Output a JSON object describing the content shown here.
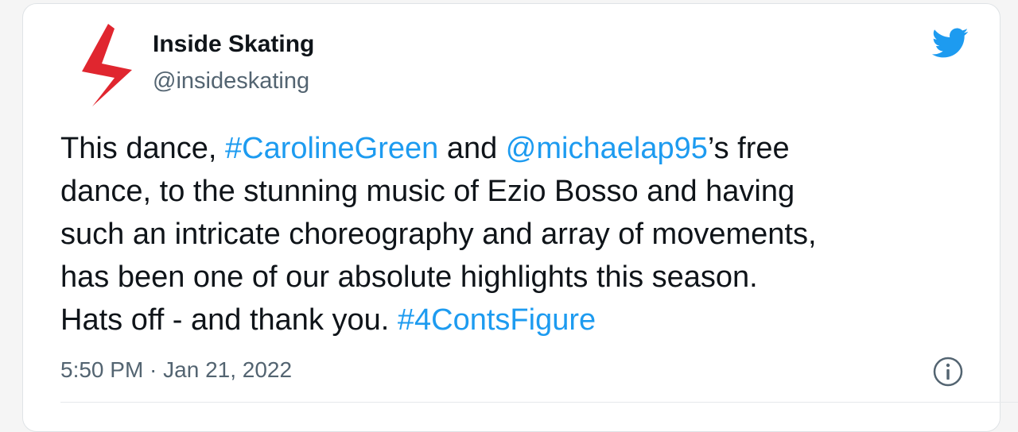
{
  "author": {
    "name": "Inside Skating",
    "handle": "@insideskating"
  },
  "tweet": {
    "lines": [
      [
        {
          "text": "This dance, ",
          "type": "text"
        },
        {
          "text": "#CarolineGreen",
          "type": "hashtag"
        },
        {
          "text": " and ",
          "type": "text"
        },
        {
          "text": "@michaelap95",
          "type": "mention"
        },
        {
          "text": "’s free",
          "type": "text"
        }
      ],
      [
        {
          "text": "dance, to the stunning music of Ezio Bosso and having",
          "type": "text"
        }
      ],
      [
        {
          "text": "such an intricate choreography and array of movements,",
          "type": "text"
        }
      ],
      [
        {
          "text": "has been one of our absolute highlights this season.",
          "type": "text"
        }
      ],
      [
        {
          "text": "Hats off - and thank you. ",
          "type": "text"
        },
        {
          "text": "#4ContsFigure",
          "type": "hashtag"
        }
      ]
    ],
    "timestamp": "5:50 PM · Jan 21, 2022"
  },
  "icons": {
    "brand": "twitter-bird-icon",
    "avatar": "inside-skating-logo",
    "info": "info-icon"
  },
  "colors": {
    "link": "#1d9bf0",
    "text": "#0f1419",
    "secondary": "#536471",
    "logo_red": "#e0262f"
  }
}
